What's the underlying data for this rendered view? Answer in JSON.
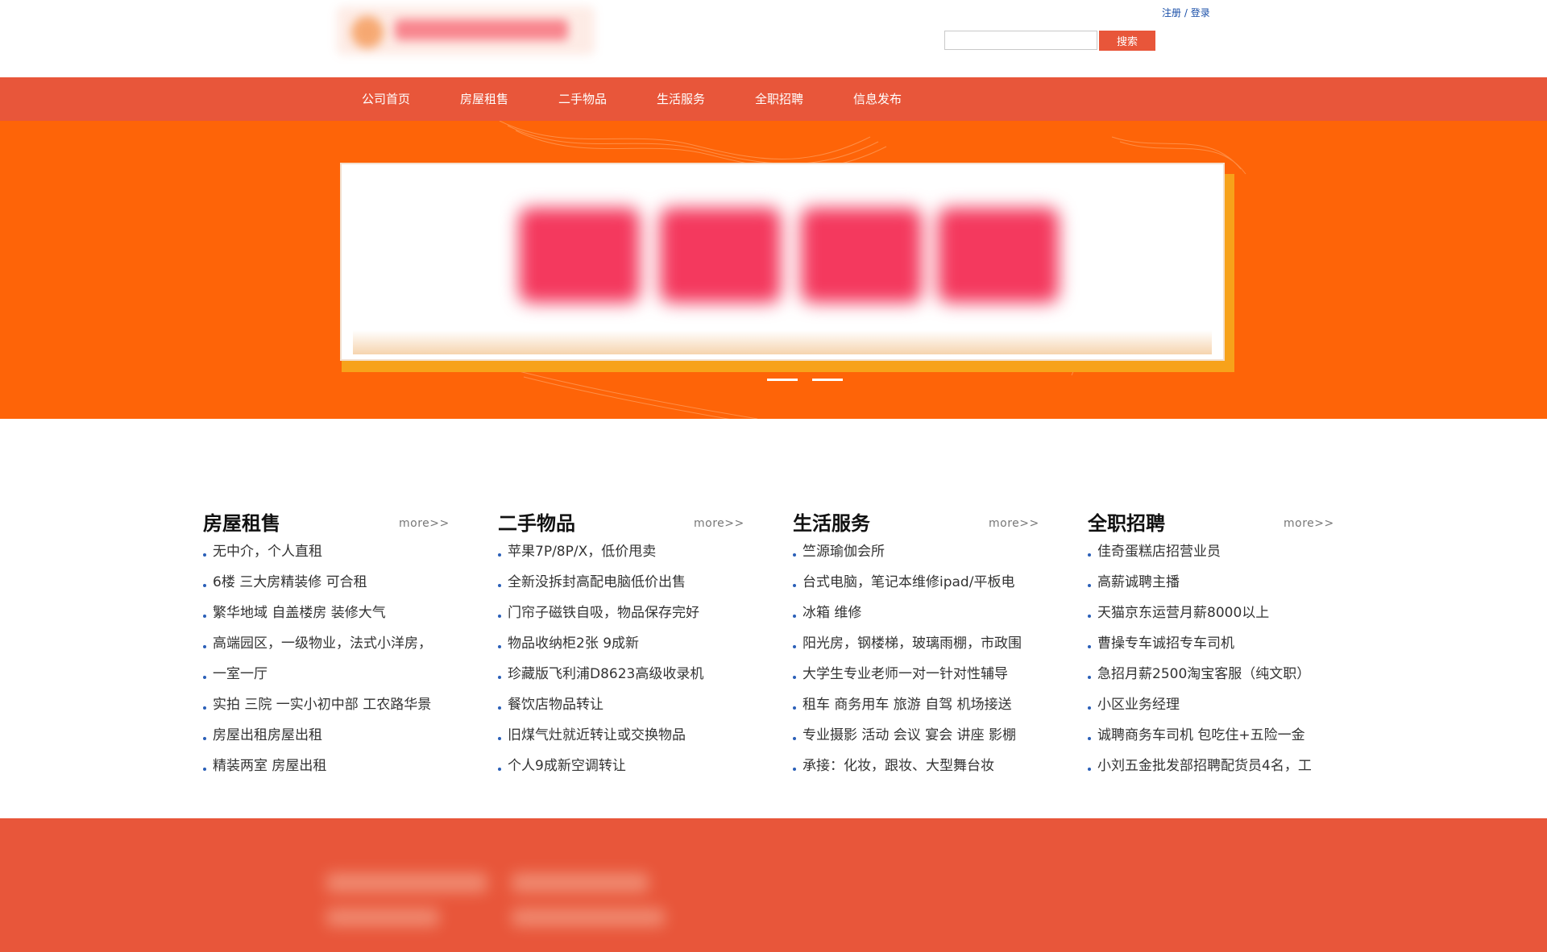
{
  "header": {
    "auth": {
      "register": "注册",
      "separator": " / ",
      "login": "登录"
    },
    "search": {
      "placeholder": "",
      "value": "",
      "button": "搜索"
    }
  },
  "nav": {
    "items": [
      {
        "label": "公司首页"
      },
      {
        "label": "房屋租售"
      },
      {
        "label": "二手物品"
      },
      {
        "label": "生活服务"
      },
      {
        "label": "全职招聘"
      },
      {
        "label": "信息发布"
      }
    ]
  },
  "banner": {
    "slides": 2,
    "active_slide": 1
  },
  "sections": [
    {
      "title": "房屋租售",
      "more": "more>>",
      "items": [
        "无中介，个人直租",
        "6楼 三大房精装修 可合租",
        "繁华地域 自盖楼房 装修大气",
        "高端园区，一级物业，法式小洋房，",
        "一室一厅",
        "实拍 三院 一实小初中部 工农路华景",
        "房屋出租房屋出租",
        "精装两室 房屋出租"
      ]
    },
    {
      "title": "二手物品",
      "more": "more>>",
      "items": [
        "苹果7P/8P/X，低价甩卖",
        "全新没拆封高配电脑低价出售",
        "门帘子磁铁自吸，物品保存完好",
        "物品收纳柜2张 9成新",
        "珍藏版飞利浦D8623高级收录机",
        "餐饮店物品转让",
        "旧煤气灶就近转让或交换物品",
        "个人9成新空调转让"
      ]
    },
    {
      "title": "生活服务",
      "more": "more>>",
      "items": [
        "竺源瑜伽会所",
        "台式电脑，笔记本维修ipad/平板电",
        "冰箱 维修",
        "阳光房，钢楼梯，玻璃雨棚，市政围",
        "大学生专业老师一对一针对性辅导",
        "租车 商务用车 旅游 自驾 机场接送",
        "专业摄影 活动 会议 宴会 讲座 影棚",
        "承接：化妆，跟妆、大型舞台妆"
      ]
    },
    {
      "title": "全职招聘",
      "more": "more>>",
      "items": [
        "佳奇蛋糕店招营业员",
        "高薪诚聘主播",
        "天猫京东运营月薪8000以上",
        "曹操专车诚招专车司机",
        "急招月薪2500淘宝客服（纯文职）",
        "小区业务经理",
        "诚聘商务车司机 包吃住+五险一金",
        "小刘五金批发部招聘配货员4名，工"
      ]
    }
  ],
  "colors": {
    "nav_bg": "#e8563a",
    "banner_bg": "#fe6408",
    "accent": "#e8563a",
    "link_blue": "#1a4fa8",
    "bullet_blue": "#2a5fb8"
  }
}
